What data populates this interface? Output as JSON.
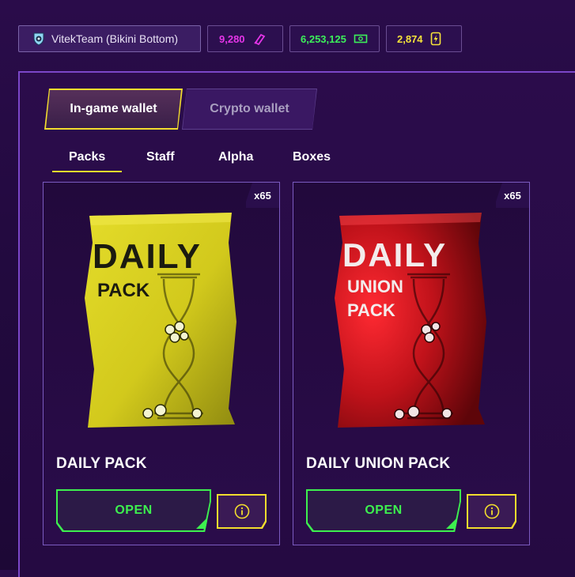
{
  "header": {
    "team": {
      "label": "VitekTeam (Bikini Bottom)",
      "icon": "team-badge-icon"
    },
    "gems": {
      "value": "9,280",
      "icon": "gem-icon",
      "color": "#e535e8"
    },
    "cash": {
      "value": "6,253,125",
      "icon": "cash-icon",
      "color": "#3cf05a"
    },
    "energy": {
      "value": "2,874",
      "icon": "energy-icon",
      "color": "#f5e23a"
    }
  },
  "wallet_tabs": [
    {
      "label": "In-game wallet",
      "active": true
    },
    {
      "label": "Crypto wallet",
      "active": false
    }
  ],
  "sub_tabs": [
    {
      "label": "Packs",
      "active": true
    },
    {
      "label": "Staff",
      "active": false
    },
    {
      "label": "Alpha",
      "active": false
    },
    {
      "label": "Boxes",
      "active": false
    }
  ],
  "cards": [
    {
      "title": "DAILY PACK",
      "count": "x65",
      "art_lines": [
        "DAILY",
        "PACK"
      ],
      "pack_color": "#d9d21f",
      "button": "OPEN"
    },
    {
      "title": "DAILY UNION PACK",
      "count": "x65",
      "art_lines": [
        "DAILY",
        "UNION",
        "PACK"
      ],
      "pack_color": "#c0121a",
      "button": "OPEN"
    }
  ]
}
